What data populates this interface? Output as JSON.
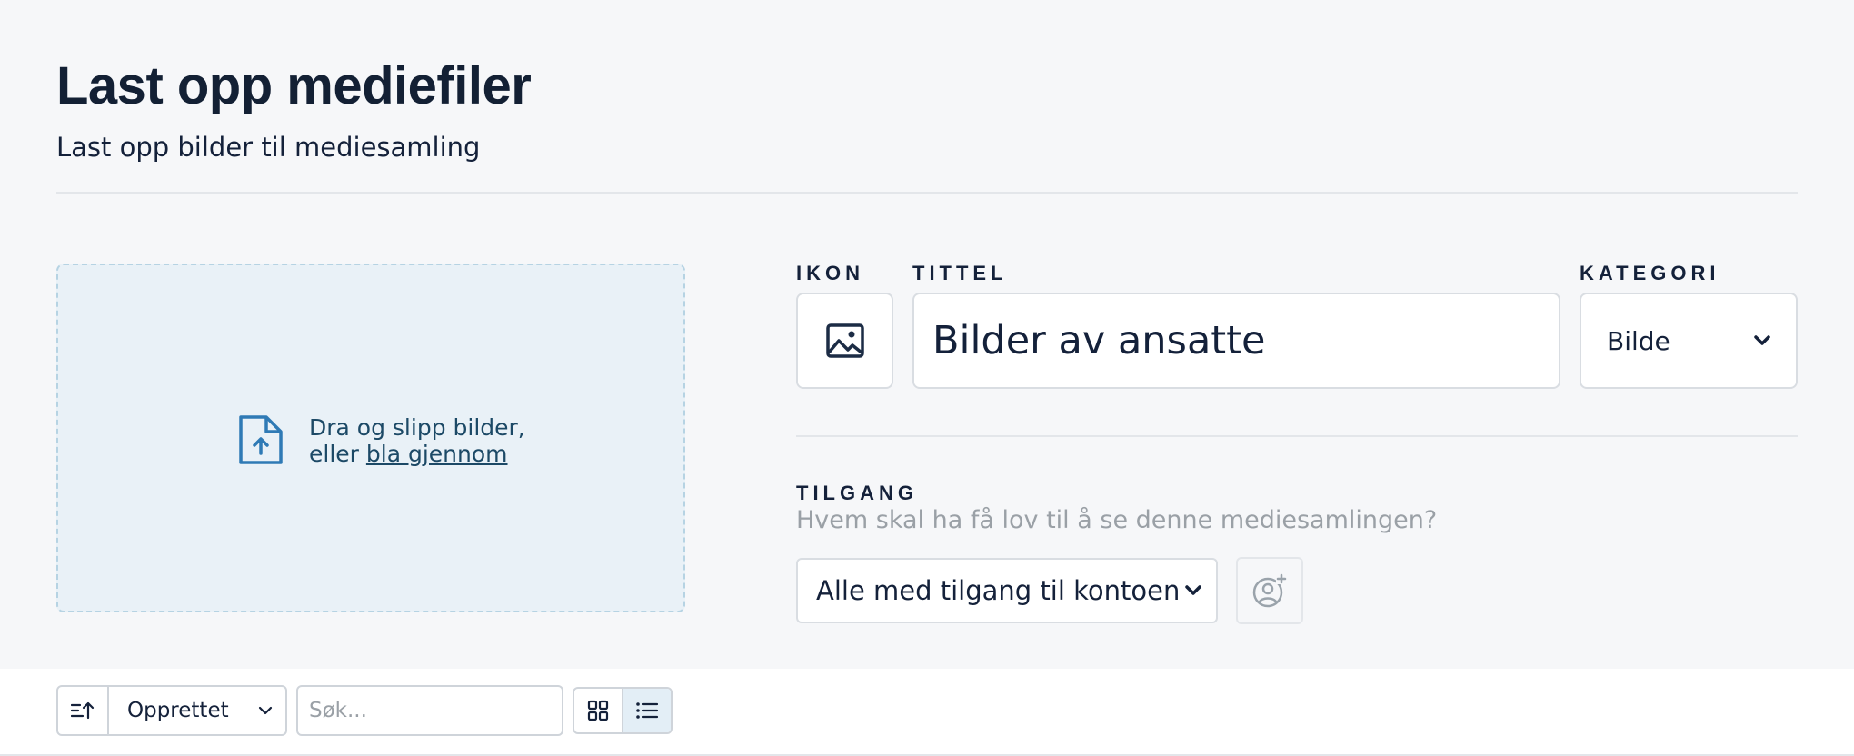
{
  "header": {
    "title": "Last opp mediefiler",
    "subtitle": "Last opp bilder til mediesamling"
  },
  "dropzone": {
    "line1": "Dra og slipp bilder,",
    "line2_prefix": "eller ",
    "browse_link": "bla gjennom",
    "icon": "file-upload-icon"
  },
  "form": {
    "icon_label": "IKON",
    "icon_button_icon": "image-icon",
    "title_label": "TITTEL",
    "title_value": "Bilder av ansatte",
    "category_label": "KATEGORI",
    "category_value": "Bilde",
    "access_label": "TILGANG",
    "access_hint": "Hvem skal ha få lov til å se denne mediesamlingen?",
    "access_value": "Alle med tilgang til kontoen",
    "add_user_icon": "user-add-icon"
  },
  "toolbar": {
    "sort_direction_icon": "sort-ascending-icon",
    "sort_field": "Opprettet",
    "search_placeholder": "Søk...",
    "search_value": "",
    "view_grid_icon": "grid-view-icon",
    "view_list_icon": "list-view-icon",
    "active_view": "list"
  },
  "colors": {
    "accent": "#2f6fa3",
    "heading": "#132034",
    "muted": "#9aa0a6",
    "border": "#d9dde2",
    "dropzone_bg": "#e9f1f7",
    "active_toggle_bg": "#e3eef6"
  }
}
